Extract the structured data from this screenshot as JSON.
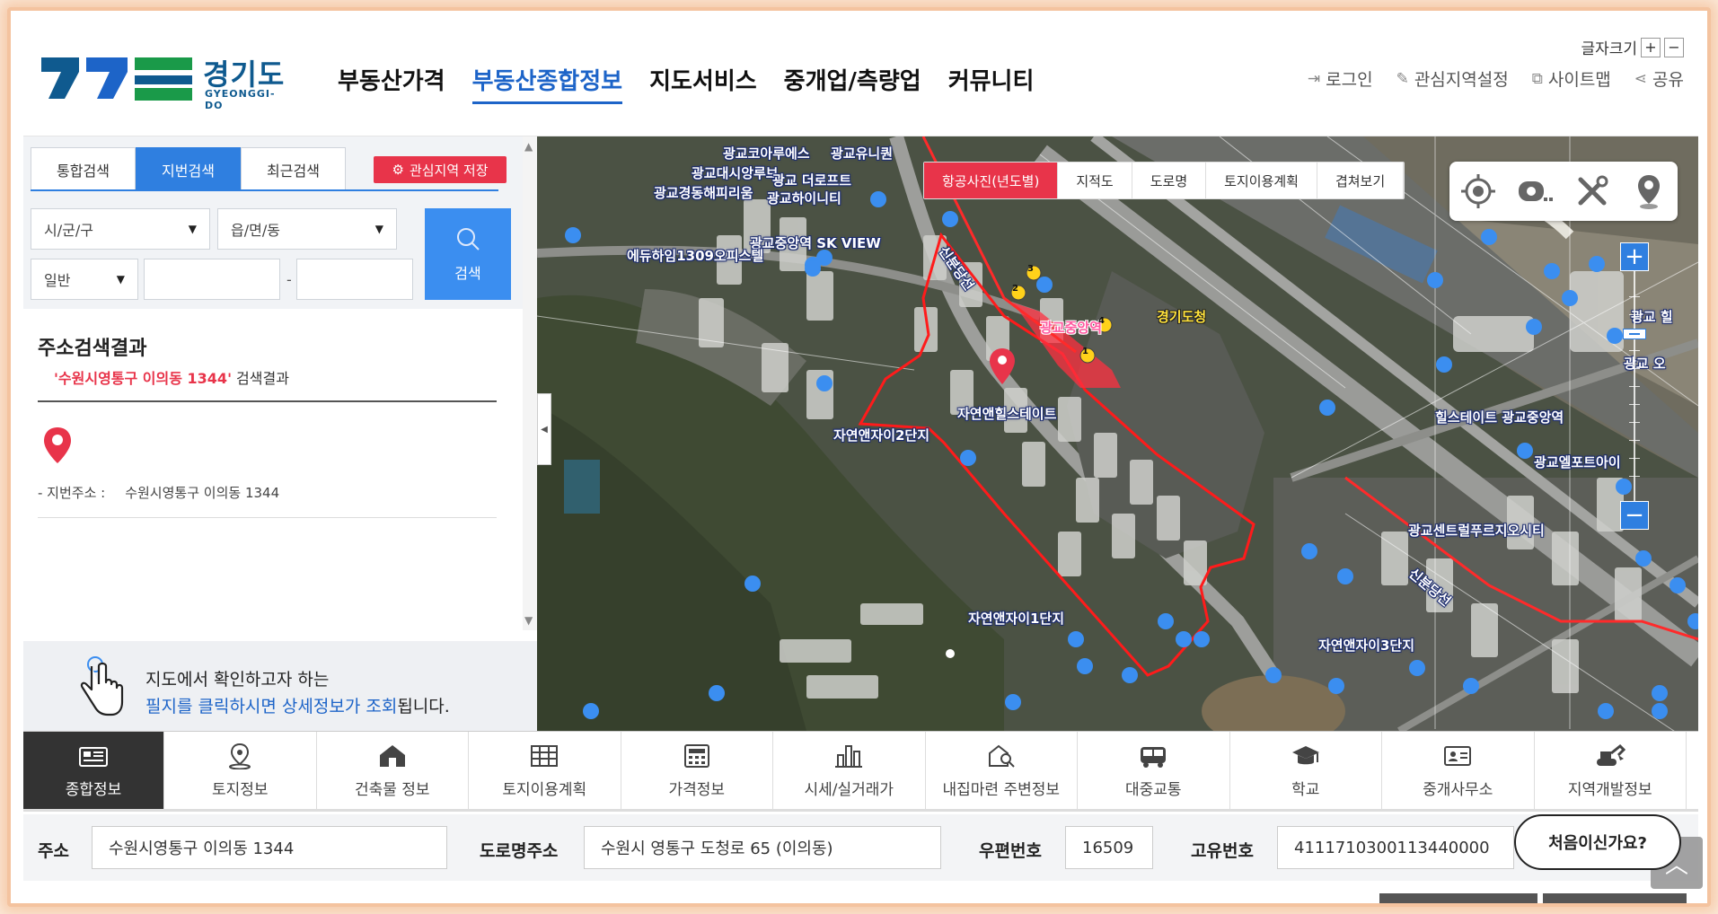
{
  "header": {
    "logo_ko": "경기도",
    "logo_en": "GYEONGGI-DO",
    "nav": [
      {
        "label": "부동산가격",
        "active": false
      },
      {
        "label": "부동산종합정보",
        "active": true
      },
      {
        "label": "지도서비스",
        "active": false
      },
      {
        "label": "중개업/측량업",
        "active": false
      },
      {
        "label": "커뮤니티",
        "active": false
      }
    ],
    "fontsize_label": "글자크기",
    "fontsize_plus": "+",
    "fontsize_minus": "−",
    "util": [
      {
        "label": "로그인",
        "icon": "login-icon",
        "glyph": "⇥"
      },
      {
        "label": "관심지역설정",
        "icon": "pin-icon",
        "glyph": "✎"
      },
      {
        "label": "사이트맵",
        "icon": "sitemap-icon",
        "glyph": "⧉"
      },
      {
        "label": "공유",
        "icon": "share-icon",
        "glyph": "⋖"
      }
    ]
  },
  "search": {
    "tabs": [
      "통합검색",
      "지번검색",
      "최근검색"
    ],
    "active_tab": "지번검색",
    "save_label": "관심지역 저장",
    "sido_select": "시/군/구",
    "dong_select": "읍/면/동",
    "type_select": "일반",
    "dash": "-",
    "search_label": "검색"
  },
  "result": {
    "title": "주소검색결과",
    "query_open": "'",
    "query": "수원시영통구 이의동 1344",
    "query_close": "'",
    "suffix": " 검색결과",
    "jibun_label": "- 지번주소 :",
    "jibun_value": "수원시영통구 이의동 1344"
  },
  "hint": {
    "line1": "지도에서 확인하고자 하는",
    "line2_blue": "필지를 클릭하시면 상세정보가 조회",
    "line2_rest": "됩니다."
  },
  "map": {
    "tabs": [
      "항공사진(년도별)",
      "지적도",
      "도로명",
      "토지이용계획",
      "겹쳐보기"
    ],
    "active_tab": "항공사진(년도별)",
    "tools": [
      "location-target-icon",
      "measure-icon",
      "tools-icon",
      "street-view-icon"
    ],
    "zoom_in": "+",
    "zoom_out": "−",
    "labels": [
      {
        "text": "광교코아루에스",
        "style": "normal"
      },
      {
        "text": "광교유니퀀",
        "style": "normal"
      },
      {
        "text": "광교대시앙루브",
        "style": "normal"
      },
      {
        "text": "광교 더로프트",
        "style": "normal"
      },
      {
        "text": "광교경동해피리움",
        "style": "normal"
      },
      {
        "text": "광교하이니티",
        "style": "normal"
      },
      {
        "text": "광교중앙역 SK VIEW",
        "style": "normal"
      },
      {
        "text": "에듀하임1309오피스텔",
        "style": "normal"
      },
      {
        "text": "신분당선",
        "style": "normal"
      },
      {
        "text": "광교중앙역",
        "style": "pink"
      },
      {
        "text": "경기도청",
        "style": "yellow"
      },
      {
        "text": "광교 힐",
        "style": "normal"
      },
      {
        "text": "자연앤자이2단지",
        "style": "normal"
      },
      {
        "text": "자연앤힐스테이트",
        "style": "normal"
      },
      {
        "text": "힐스테이트 광교중앙역",
        "style": "normal"
      },
      {
        "text": "광교엘포트아이",
        "style": "normal"
      },
      {
        "text": "광교센트럴푸르지오시티",
        "style": "normal"
      },
      {
        "text": "신분당선",
        "style": "normal"
      },
      {
        "text": "자연앤자이1단지",
        "style": "normal"
      },
      {
        "text": "자연앤자이3단지",
        "style": "normal"
      },
      {
        "text": "광교 오",
        "style": "normal"
      }
    ],
    "exit_numbers": [
      "3",
      "2",
      "4",
      "1"
    ]
  },
  "categories": [
    {
      "label": "종합정보",
      "icon": "info-grid-icon",
      "active": true
    },
    {
      "label": "토지정보",
      "icon": "land-pin-icon",
      "active": false
    },
    {
      "label": "건축물 정보",
      "icon": "building-icon",
      "active": false
    },
    {
      "label": "토지이용계획",
      "icon": "land-plan-icon",
      "active": false
    },
    {
      "label": "가격정보",
      "icon": "price-icon",
      "active": false
    },
    {
      "label": "시세/실거래가",
      "icon": "chart-icon",
      "active": false
    },
    {
      "label": "내집마련 주변정보",
      "icon": "house-search-icon",
      "active": false
    },
    {
      "label": "대중교통",
      "icon": "bus-icon",
      "active": false
    },
    {
      "label": "학교",
      "icon": "school-icon",
      "active": false
    },
    {
      "label": "중개사무소",
      "icon": "agent-card-icon",
      "active": false
    },
    {
      "label": "지역개발정보",
      "icon": "excavator-icon",
      "active": false
    }
  ],
  "info": {
    "addr_label": "주소",
    "addr_value": "수원시영통구 이의동 1344",
    "road_label": "도로명주소",
    "road_value": "수원시 영통구 도청로 65 (이의동)",
    "zip_label": "우편번호",
    "zip_value": "16509",
    "uid_label": "고유번호",
    "uid_value": "4111710300113440000",
    "first_btn": "처음이신가요?"
  },
  "top_button": "︿",
  "colors": {
    "brand_blue": "#1d64c8",
    "accent_red": "#e8344a",
    "button_blue": "#3b8ef0",
    "logo_green": "#1a9a49",
    "logo_blue": "#0f5a8f"
  }
}
